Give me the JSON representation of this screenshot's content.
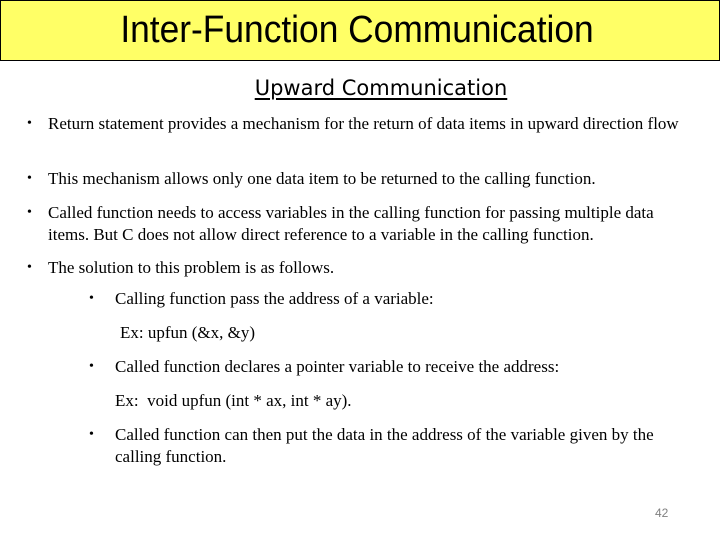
{
  "slide": {
    "title": "Inter-Function Communication",
    "subtitle": "Upward Communication",
    "bullets": [
      {
        "marker": "•",
        "text": "Return statement provides a mechanism for the return of data items in upward direction flow"
      },
      {
        "marker": "•",
        "text": "This mechanism allows only one data item to be returned to the calling function."
      },
      {
        "marker": "•",
        "text": "Called function needs to access variables in the calling function for passing multiple data items. But C does not allow direct reference to a variable in the calling function."
      },
      {
        "marker": "•",
        "text": "The solution to this problem is as follows."
      }
    ],
    "sub_bullets": [
      {
        "marker": "•",
        "text": "Calling function pass the address of a variable:",
        "example": "Ex: upfun (&x, &y)"
      },
      {
        "marker": "•",
        "text": "Called function declares a pointer variable to receive the address:",
        "example": "Ex:  void upfun (int * ax, int * ay)."
      },
      {
        "marker": "•",
        "text": "Called function can then put the data in the address of the variable given by the calling function."
      }
    ],
    "page_number": "42"
  },
  "colors": {
    "title_background": "#ffff66",
    "title_border": "#000000",
    "text": "#000000",
    "page_number": "#808080"
  }
}
